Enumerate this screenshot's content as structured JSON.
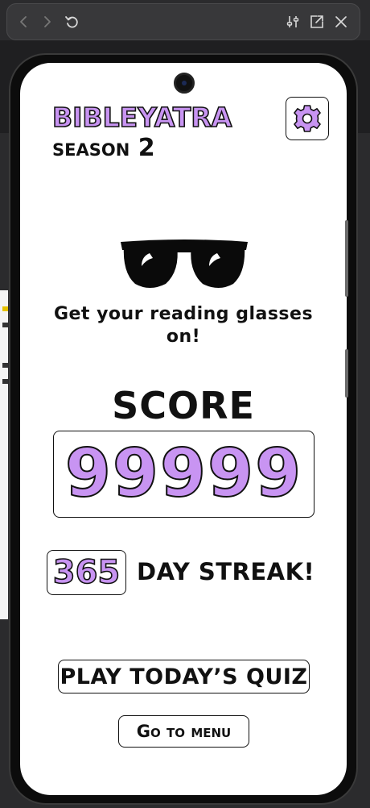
{
  "browser": {
    "back_icon": "chevron-left-icon",
    "forward_icon": "chevron-right-icon",
    "reload_icon": "reload-icon",
    "settings_icon": "sliders-icon",
    "open_external_icon": "open-external-icon",
    "close_icon": "close-icon"
  },
  "app": {
    "title": "BIBLEYATRA",
    "season": "season 2",
    "settings_icon": "gear-icon",
    "glasses_icon": "sunglasses-icon",
    "tagline": "Get your reading glasses on!",
    "score_label": "SCORE",
    "score_value": "99999",
    "streak_value": "365",
    "streak_label": "DAY STREAK!",
    "play_button": "PLAY TODAY’S QUIZ",
    "menu_button": "Go to menu"
  },
  "colors": {
    "accent": "#c894f2",
    "ink": "#111111",
    "screen": "#ffffff",
    "frame": "#0c0c0c"
  }
}
